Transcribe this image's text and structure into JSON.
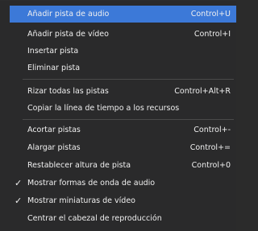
{
  "menu": {
    "items": [
      {
        "label": "Añadir pista de audio",
        "shortcut": "Control+U",
        "checked": false,
        "highlighted": true
      },
      {
        "label": "Añadir pista de vídeo",
        "shortcut": "Control+I",
        "checked": false,
        "highlighted": false
      },
      {
        "label": "Insertar pista",
        "shortcut": "",
        "checked": false,
        "highlighted": false
      },
      {
        "label": "Eliminar pista",
        "shortcut": "",
        "checked": false,
        "highlighted": false
      },
      {
        "label": "Rizar todas las pistas",
        "shortcut": "Control+Alt+R",
        "checked": false,
        "highlighted": false
      },
      {
        "label": "Copiar la línea de tiempo a los recursos",
        "shortcut": "",
        "checked": false,
        "highlighted": false
      },
      {
        "label": "Acortar pistas",
        "shortcut": "Control+-",
        "checked": false,
        "highlighted": false
      },
      {
        "label": "Alargar pistas",
        "shortcut": "Control+=",
        "checked": false,
        "highlighted": false
      },
      {
        "label": "Restablecer altura de pista",
        "shortcut": "Control+0",
        "checked": false,
        "highlighted": false
      },
      {
        "label": "Mostrar formas de onda de audio",
        "shortcut": "",
        "checked": true,
        "highlighted": false
      },
      {
        "label": "Mostrar miniaturas de vídeo",
        "shortcut": "",
        "checked": true,
        "highlighted": false
      },
      {
        "label": "Centrar el cabezal de reproducción",
        "shortcut": "",
        "checked": false,
        "highlighted": false
      }
    ],
    "check_glyph": "✓",
    "colors": {
      "background": "#2a2a2b",
      "highlight": "#3c79d8",
      "text": "#f0f0f0",
      "separator": "#4a4a4a"
    }
  }
}
